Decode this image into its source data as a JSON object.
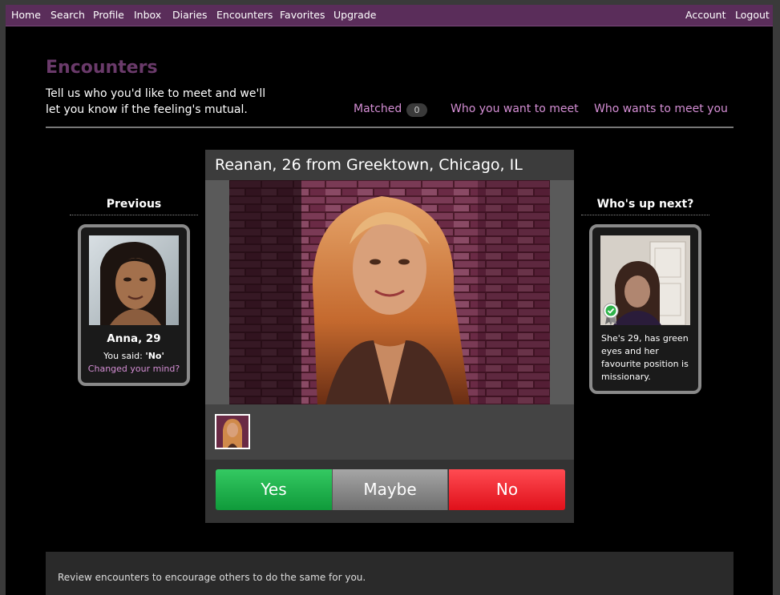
{
  "nav": {
    "left": [
      "Home",
      "Search",
      "Profile",
      "Inbox",
      "Diaries",
      "Encounters",
      "Favorites",
      "Upgrade"
    ],
    "right": [
      "Account",
      "Logout"
    ]
  },
  "page": {
    "title": "Encounters",
    "intro": "Tell us who you'd like to meet and we'll let you know if the feeling's mutual."
  },
  "tabs": {
    "matched": "Matched",
    "matched_count": "0",
    "want_to_meet": "Who you want to meet",
    "wants_to_meet_you": "Who wants to meet you"
  },
  "previous": {
    "heading": "Previous",
    "name": "Anna, 29",
    "you_said_prefix": "You said: ",
    "you_said_value": "'No'",
    "changed_mind": "Changed your mind?"
  },
  "current": {
    "title": "Reanan, 26 from Greektown, Chicago, IL"
  },
  "votes": {
    "yes": "Yes",
    "maybe": "Maybe",
    "no": "No"
  },
  "next": {
    "heading": "Who's up next?",
    "description": "She's 29, has green eyes and her favourite position is missionary.",
    "verified_icon": "verified-badge-icon"
  },
  "footer": {
    "text": "Review encounters to encourage others to do the same for you."
  },
  "colors": {
    "topbar": "#5a2d5a",
    "title": "#6a3a6a",
    "link": "#d48ed4",
    "yes": "#1fa84a",
    "maybe": "#8a8a8a",
    "no": "#ee1c24"
  }
}
